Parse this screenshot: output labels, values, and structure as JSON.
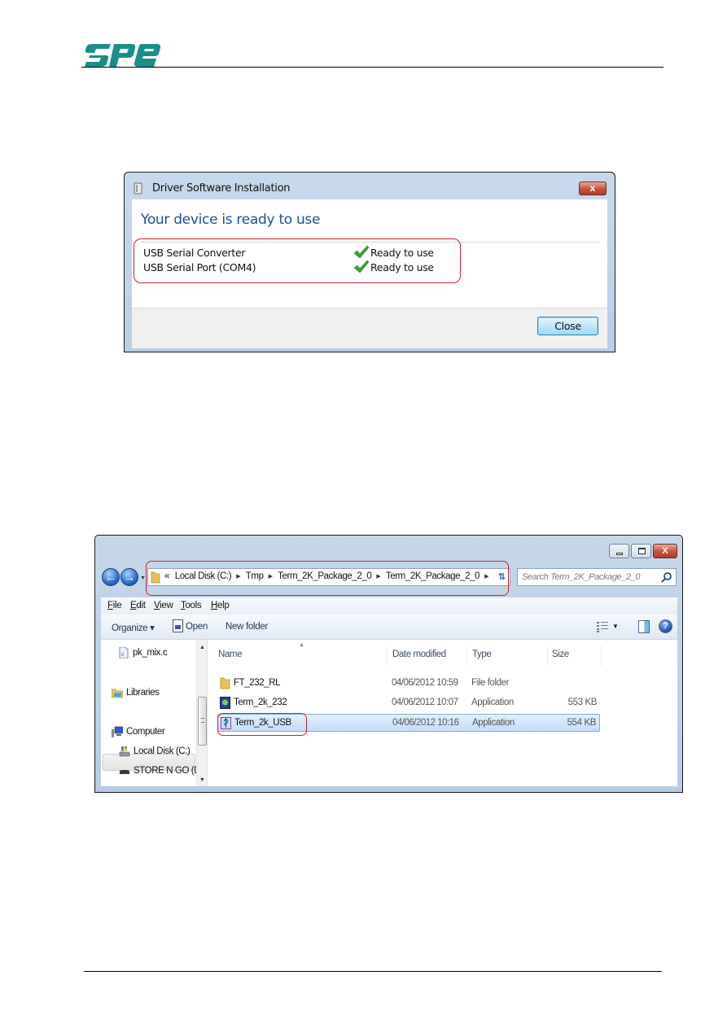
{
  "document": {
    "logo_text": "spe",
    "brand_color": "#1a8f8a"
  },
  "driver_dialog": {
    "title": "Driver Software Installation",
    "heading": "Your device is ready to use",
    "devices": [
      {
        "name": "USB Serial Converter",
        "status": "Ready to use"
      },
      {
        "name": "USB Serial Port (COM4)",
        "status": "Ready to use"
      }
    ],
    "close_button": "Close",
    "close_x": "x",
    "heading_color": "#1f4f9c",
    "highlight_color": "#d0202a"
  },
  "explorer": {
    "window_close": "X",
    "breadcrumb": {
      "overflow": "«",
      "items": [
        "Local Disk (C:)",
        "Tmp",
        "Term_2K_Package_2_0",
        "Term_2K_Package_2_0"
      ]
    },
    "search_placeholder": "Search Term_2K_Package_2_0",
    "menu": [
      {
        "underline": "F",
        "rest": "ile"
      },
      {
        "underline": "E",
        "rest": "dit"
      },
      {
        "underline": "V",
        "rest": "iew"
      },
      {
        "underline": "T",
        "rest": "ools"
      },
      {
        "underline": "H",
        "rest": "elp"
      }
    ],
    "toolbar": {
      "organize": "Organize ▾",
      "open": "Open",
      "new_folder": "New folder"
    },
    "nav_pane": [
      {
        "label": "pk_mix.c",
        "icon": "c-file-icon"
      },
      {
        "label": "Libraries",
        "icon": "libraries-icon"
      },
      {
        "label": "Computer",
        "icon": "computer-icon"
      },
      {
        "label": "Local Disk (C:)",
        "icon": "local-disk-icon",
        "selected": true
      },
      {
        "label": "STORE N GO (D:)",
        "icon": "usb-drive-icon"
      }
    ],
    "columns": [
      "Name",
      "Date modified",
      "Type",
      "Size"
    ],
    "files": [
      {
        "name": "FT_232_RL",
        "date": "04/06/2012 10:59",
        "type": "File folder",
        "size": "",
        "icon": "folder-icon"
      },
      {
        "name": "Term_2k_232",
        "date": "04/06/2012 10:07",
        "type": "Application",
        "size": "553 KB",
        "icon": "application-icon"
      },
      {
        "name": "Term_2k_USB",
        "date": "04/06/2012 10:16",
        "type": "Application",
        "size": "554 KB",
        "icon": "usb-application-icon",
        "selected": true
      }
    ]
  }
}
